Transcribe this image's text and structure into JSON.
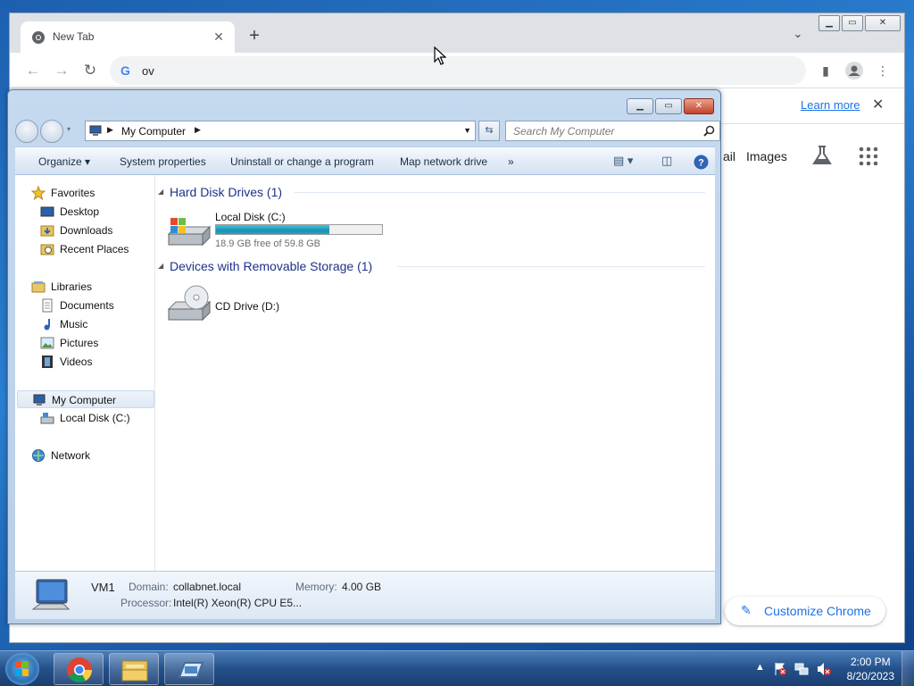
{
  "chrome": {
    "tab_title": "New Tab",
    "omnibox_text": "ov",
    "learn_more": "Learn more",
    "gmail_partial": "ail",
    "images_link": "Images",
    "customize_label": "Customize Chrome"
  },
  "explorer": {
    "address": "My Computer",
    "search_placeholder": "Search My Computer",
    "commands": [
      "Organize",
      "System properties",
      "Uninstall or change a program",
      "Map network drive",
      "»"
    ],
    "nav": {
      "favorites": "Favorites",
      "desktop": "Desktop",
      "downloads": "Downloads",
      "recent_places": "Recent Places",
      "libraries": "Libraries",
      "documents": "Documents",
      "music": "Music",
      "pictures": "Pictures",
      "videos": "Videos",
      "my_computer": "My Computer",
      "local_disk": "Local Disk (C:)",
      "network": "Network"
    },
    "groups": {
      "hdd": "Hard Disk Drives (1)",
      "removable": "Devices with Removable Storage (1)"
    },
    "drives": {
      "c_name": "Local Disk (C:)",
      "c_free": "18.9 GB free of 59.8 GB",
      "c_used_fraction": 0.684,
      "d_name": "CD Drive (D:)"
    },
    "details": {
      "computer_name": "VM1",
      "domain_label": "Domain:",
      "domain_value": "collabnet.local",
      "memory_label": "Memory:",
      "memory_value": "4.00 GB",
      "processor_label": "Processor:",
      "processor_value": "Intel(R) Xeon(R) CPU E5..."
    }
  },
  "taskbar": {
    "time": "2:00 PM",
    "date": "8/20/2023"
  }
}
